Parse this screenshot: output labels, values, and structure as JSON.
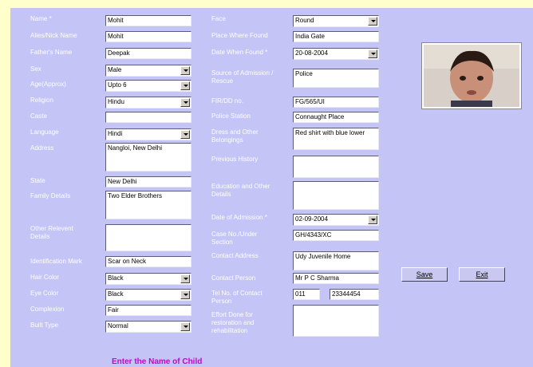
{
  "left": {
    "name": {
      "label": "Name *",
      "value": "Mohit"
    },
    "alias": {
      "label": "Alies/Nick Name",
      "value": "Mohit"
    },
    "father": {
      "label": "Father's Name",
      "value": "Deepak"
    },
    "sex": {
      "label": "Sex",
      "value": "Male"
    },
    "age": {
      "label": "Age(Approx)",
      "value": "Upto 6"
    },
    "religion": {
      "label": "Religion",
      "value": "Hindu"
    },
    "caste": {
      "label": "Caste",
      "value": ""
    },
    "language": {
      "label": "Language",
      "value": "Hindi"
    },
    "address": {
      "label": "Address",
      "value": "Nangloi, New Delhi"
    },
    "state": {
      "label": "State",
      "value": "New Delhi"
    },
    "family": {
      "label": "Family Details",
      "value": "Two Elder Brothers"
    },
    "other": {
      "label": "Other Relevent Details",
      "value": ""
    },
    "ident": {
      "label": "Identification Mark",
      "value": "Scar on Neck"
    },
    "hair": {
      "label": "Hair Color",
      "value": "Black"
    },
    "eye": {
      "label": "Eye Color",
      "value": "Black"
    },
    "complexion": {
      "label": "Complexion",
      "value": "Fair"
    },
    "built": {
      "label": "Built Type",
      "value": "Normal"
    }
  },
  "middle": {
    "face": {
      "label": "Face",
      "value": "Round"
    },
    "place": {
      "label": "Place Where Found",
      "value": "India Gate"
    },
    "date_found": {
      "label": "Date When Found *",
      "value": "20-08-2004"
    },
    "source": {
      "label": "Source of Admission / Rescue",
      "value": "Police"
    },
    "fir": {
      "label": "FIR/DD no.",
      "value": "FG/565/UI"
    },
    "police": {
      "label": "Police Station",
      "value": "Connaught Place"
    },
    "dress": {
      "label": "Dress and Other Belongings",
      "value": "Red shirt with blue lower"
    },
    "history": {
      "label": "Previous History",
      "value": ""
    },
    "education": {
      "label": "Education and Other Details",
      "value": ""
    },
    "date_adm": {
      "label": "Date of Admission *",
      "value": "02-09-2004"
    },
    "case": {
      "label": "Case No./Under Section",
      "value": "GH/4343/XC"
    },
    "contact_addr": {
      "label": "Contact Address",
      "value": "Udy Juvenile Home"
    },
    "contact_person": {
      "label": "Contact Person",
      "value": "Mr P C Sharma"
    },
    "tel": {
      "label": "Tel No. of Contact Person",
      "code": "011",
      "number": "23344454"
    },
    "effort": {
      "label": "Effort Done for restoration and rehabilitation",
      "value": ""
    }
  },
  "buttons": {
    "save": "Save",
    "exit": "Exit"
  },
  "status_message": "Enter the Name of Child",
  "colors": {
    "panel": "#c4c4f6",
    "outer": "#ffffcc",
    "status": "#cc00cc"
  }
}
